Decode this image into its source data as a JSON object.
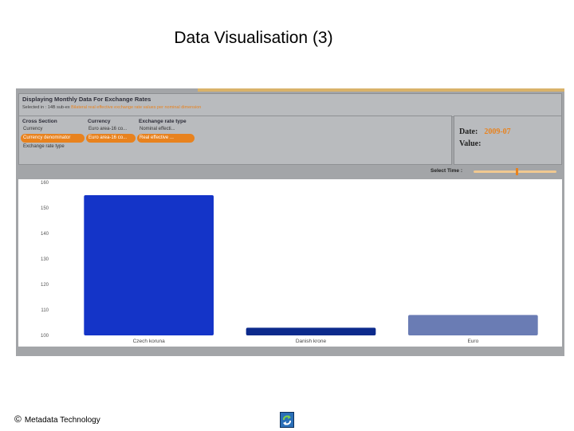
{
  "slide": {
    "title": "Data Visualisation (3)"
  },
  "app": {
    "header": {
      "title": "Displaying Monthly Data For Exchange Rates",
      "subtitle_prefix": "Selected in : 14B sub-ex",
      "subtitle_highlight": "Bilateral real effective exchange rate values per nominal dimension"
    },
    "filters": {
      "columns": [
        {
          "heading": "Cross Section",
          "options": [
            "Currency",
            "Currency denominator",
            "Exchange rate type"
          ],
          "selected": 1
        },
        {
          "heading": "Currency",
          "options": [
            "Euro area-16 co...",
            "Euro area-16 co..."
          ],
          "selected": 1
        },
        {
          "heading": "Exchange rate type",
          "options": [
            "Nominal effecti...",
            "Real effective ..."
          ],
          "selected": 1
        }
      ]
    },
    "info": {
      "date_label": "Date:",
      "date_value": "2009-07",
      "value_label": "Value:",
      "value_value": ""
    },
    "time": {
      "label": "Select Time :",
      "position": 0.52
    }
  },
  "chart_data": {
    "type": "bar",
    "categories": [
      "Czech koruna",
      "Danish krone",
      "Euro"
    ],
    "values": [
      155,
      103,
      108
    ],
    "colors": [
      "#1434c8",
      "#0c2a8c",
      "#6a7cb4"
    ],
    "ylim": [
      100,
      160
    ],
    "yticks": [
      100,
      110,
      120,
      130,
      140,
      150,
      160
    ],
    "ytick_labels": [
      "100",
      "110",
      "120",
      "130",
      "140",
      "150",
      "160"
    ],
    "title": "",
    "xlabel": "",
    "ylabel": ""
  },
  "footer": {
    "copyright_symbol": "©",
    "text": "Metadata Technology",
    "logo": "refresh-arrows-icon"
  }
}
